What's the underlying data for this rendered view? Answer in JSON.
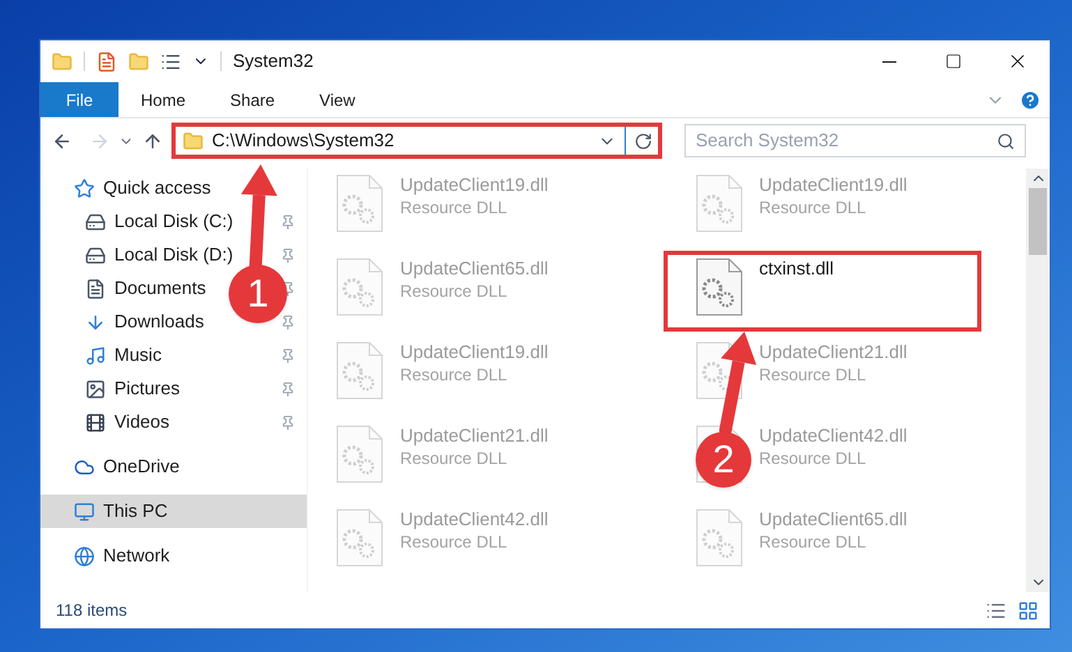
{
  "window": {
    "title": "System32"
  },
  "ribbon": {
    "tabs": [
      {
        "label": "File",
        "selected": true
      },
      {
        "label": "Home",
        "selected": false
      },
      {
        "label": "Share",
        "selected": false
      },
      {
        "label": "View",
        "selected": false
      }
    ]
  },
  "address_bar": {
    "path": "C:\\Windows\\System32",
    "highlighted": true
  },
  "search": {
    "placeholder": "Search System32"
  },
  "sidebar": {
    "items": [
      {
        "label": "Quick access",
        "kind": "star",
        "selected": false,
        "children": [
          {
            "label": "Local Disk (C:)",
            "kind": "drive",
            "pinned": true
          },
          {
            "label": "Local Disk (D:)",
            "kind": "drive",
            "pinned": true
          },
          {
            "label": "Documents",
            "kind": "documents",
            "pinned": true
          },
          {
            "label": "Downloads",
            "kind": "downloads",
            "pinned": true
          },
          {
            "label": "Music",
            "kind": "music",
            "pinned": true
          },
          {
            "label": "Pictures",
            "kind": "pictures",
            "pinned": true
          },
          {
            "label": "Videos",
            "kind": "videos",
            "pinned": true
          }
        ]
      },
      {
        "label": "OneDrive",
        "kind": "cloud",
        "selected": false
      },
      {
        "label": "This PC",
        "kind": "pc",
        "selected": true
      },
      {
        "label": "Network",
        "kind": "network",
        "selected": false
      }
    ]
  },
  "files": [
    {
      "name": "UpdateClient19.dll",
      "type": "Resource DLL",
      "dimmed": true,
      "highlighted": false
    },
    {
      "name": "UpdateClient19.dll",
      "type": "Resource DLL",
      "dimmed": true,
      "highlighted": false
    },
    {
      "name": "UpdateClient65.dll",
      "type": "Resource DLL",
      "dimmed": true,
      "highlighted": false
    },
    {
      "name": "ctxinst.dll",
      "dimmed": false,
      "highlighted": true
    },
    {
      "name": "UpdateClient19.dll",
      "type": "Resource DLL",
      "dimmed": true,
      "highlighted": false
    },
    {
      "name": "UpdateClient21.dll",
      "type": "Resource DLL",
      "dimmed": true,
      "highlighted": false
    },
    {
      "name": "UpdateClient21.dll",
      "type": "Resource DLL",
      "dimmed": true,
      "highlighted": false
    },
    {
      "name": "UpdateClient42.dll",
      "type": "Resource DLL",
      "dimmed": true,
      "highlighted": false
    },
    {
      "name": "UpdateClient42.dll",
      "type": "Resource DLL",
      "dimmed": true,
      "highlighted": false
    },
    {
      "name": "UpdateClient65.dll",
      "type": "Resource DLL",
      "dimmed": true,
      "highlighted": false
    }
  ],
  "status_bar": {
    "item_count": "118 items"
  },
  "annotations": [
    {
      "label": "1"
    },
    {
      "label": "2"
    }
  ]
}
